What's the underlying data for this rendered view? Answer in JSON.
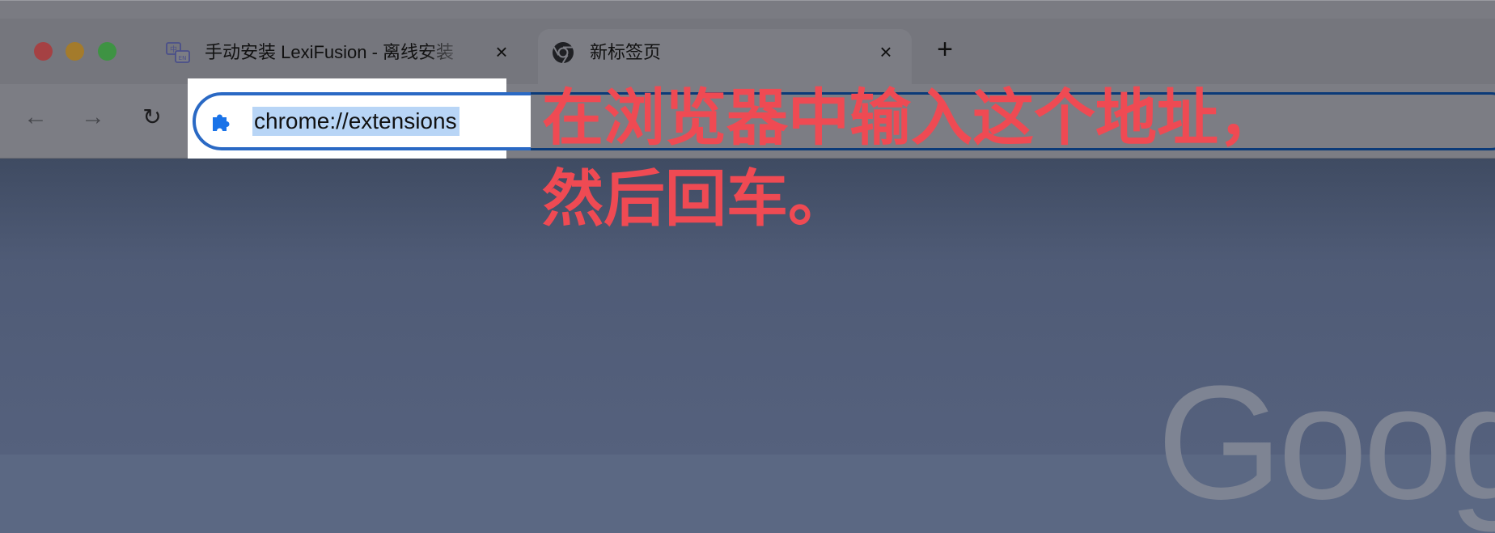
{
  "window": {
    "traffic_lights": [
      "close",
      "minimize",
      "zoom"
    ]
  },
  "tabs": [
    {
      "title": "手动安装 LexiFusion - 离线安装",
      "icon": "lexifusion-translate-icon",
      "close_label": "×"
    },
    {
      "title": "新标签页",
      "icon": "chrome-icon",
      "close_label": "×"
    }
  ],
  "new_tab_label": "+",
  "toolbar": {
    "back_label": "←",
    "forward_label": "→",
    "reload_label": "↻"
  },
  "omnibox": {
    "icon": "extension-puzzle-icon",
    "url": "chrome://extensions"
  },
  "annotation": {
    "line1": "在浏览器中输入这个地址，",
    "line2": "然后回车。",
    "color": "#ef4a53"
  },
  "page": {
    "logo_text": "Goog"
  },
  "colors": {
    "omnibox_border": "#2a69c4",
    "selection": "#b8d5f6",
    "tabstrip": "#75767d",
    "content_bg": "#55617d"
  }
}
